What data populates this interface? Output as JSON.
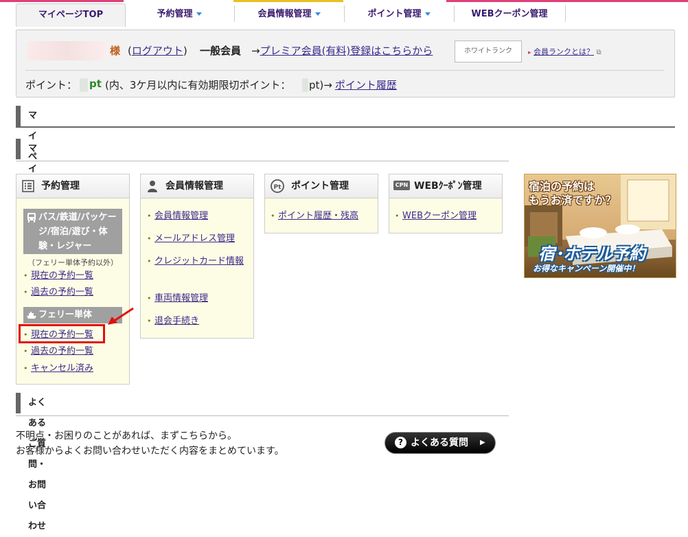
{
  "nav": {
    "tabs": [
      {
        "label": "マイページTOP",
        "active": true
      },
      {
        "label": "予約管理",
        "dropdown": true
      },
      {
        "label": "会員情報管理",
        "dropdown": true
      },
      {
        "label": "ポイント管理",
        "dropdown": true
      },
      {
        "label": "WEBクーポン管理"
      }
    ]
  },
  "user": {
    "honorific": "様",
    "logout_open": "(",
    "logout_label": "ログアウト",
    "logout_close": ")",
    "member_type": "一般会員",
    "premium_prefix": "→",
    "premium_link": "プレミア会員(有料)登録はこちらから",
    "rank_badge": "ホワイトランク",
    "rank_link": "会員ランクとは？",
    "points_label": "ポイント：",
    "points_unit": "pt",
    "points_expiring": "(内、3ケ月以内に有効期限切ポイント：",
    "points_expiring_end": "pt)→",
    "points_history_link": "ポイント履歴"
  },
  "sections": {
    "mypage": "マイページ",
    "menu": "マイページメニュー",
    "faq": "よくあるご質問・お問い合わせ"
  },
  "menu": {
    "reservation": {
      "title": "予約管理",
      "bus_group": "バス/鉄道/パッケージ/宿泊/遊び・体験・レジャー",
      "bus_note": "（フェリー単体予約以外）",
      "bus_links": [
        "現在の予約一覧",
        "過去の予約一覧"
      ],
      "ferry_group": "フェリー単体",
      "ferry_links": [
        "現在の予約一覧",
        "過去の予約一覧",
        "キャンセル済み"
      ]
    },
    "member": {
      "title": "会員情報管理",
      "links": [
        "会員情報管理",
        "メールアドレス管理",
        "クレジットカード情報",
        "車両情報管理",
        "退会手続き"
      ]
    },
    "points": {
      "title": "ポイント管理",
      "links": [
        "ポイント履歴・残高"
      ]
    },
    "coupon": {
      "title": "WEBｸｰﾎﾟﾝ管理",
      "icon_text": "CPN",
      "links": [
        "WEBクーポン管理"
      ]
    }
  },
  "banner": {
    "line1": "宿泊の予約は",
    "line2": "もうお済ですか？",
    "big": "宿･ホテル予約",
    "sub": "お得なキャンペーン開催中！"
  },
  "faq": {
    "text1": "不明点・お困りのことがあれば、まずこちらから。",
    "text2": "お客様からよくお問い合わせいただく内容をまとめています。",
    "button": "よくある質問"
  },
  "colors": {
    "link": "#3a2a8a",
    "accent_red": "#e01010",
    "box_bg": "#fdfde6",
    "points_green": "#2a8a2a",
    "stripe_pink": "#e0407a",
    "stripe_yellow": "#e8c020"
  }
}
